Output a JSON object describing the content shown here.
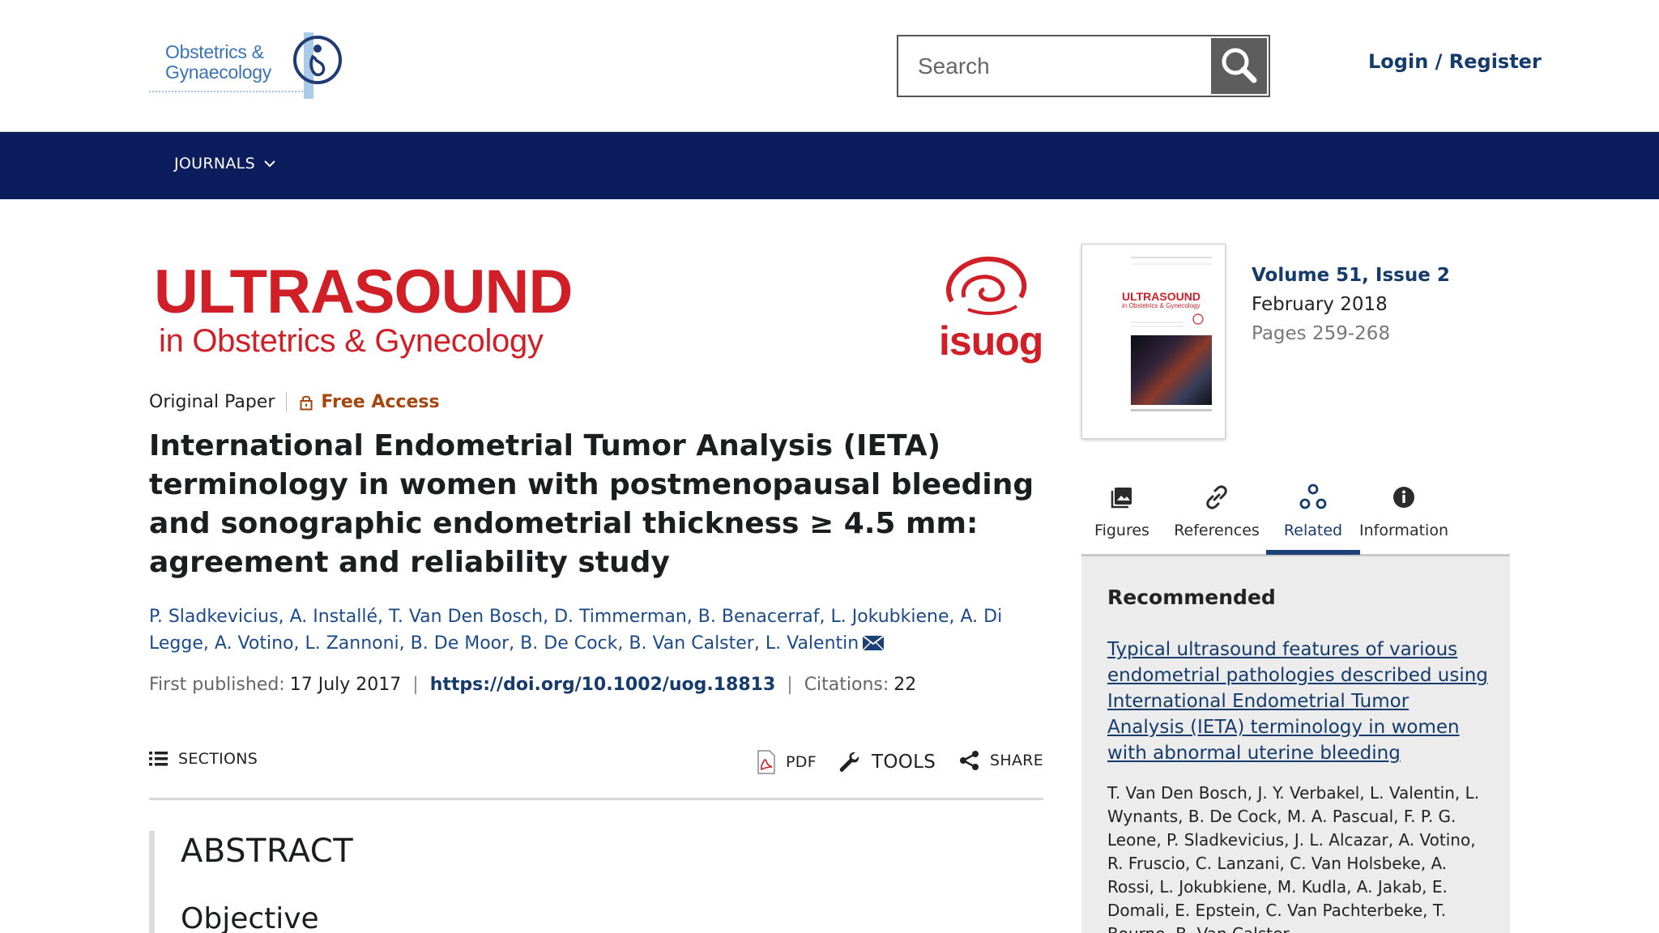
{
  "header": {
    "brand_line1": "Obstetrics &",
    "brand_line2": "Gynaecology",
    "search_placeholder": "Search",
    "login_label": "Login / Register"
  },
  "nav": {
    "journals_label": "JOURNALS"
  },
  "journal": {
    "logo_title": "ULTRASOUND",
    "logo_subtitle": "in Obstetrics & Gynecology",
    "isuog": "isuog"
  },
  "article": {
    "type": "Original Paper",
    "access": "Free Access",
    "title": "International Endometrial Tumor Analysis (IETA) terminology in women with postmenopausal bleeding and sonographic endometrial thickness ≥ 4.5 mm: agreement and reliability study",
    "authors": [
      "P. Sladkevicius",
      "A. Installé",
      "T. Van Den Bosch",
      "D. Timmerman",
      "B. Benacerraf",
      "L. Jokubkiene",
      "A. Di Legge",
      "A. Votino",
      "L. Zannoni",
      "B. De Moor",
      "B. De Cock",
      "B. Van Calster",
      "L. Valentin"
    ],
    "first_published_label": "First published:",
    "first_published": "17 July 2017",
    "doi": "https://doi.org/10.1002/uog.18813",
    "citations_label": "Citations:",
    "citations": "22"
  },
  "toolbar": {
    "sections": "SECTIONS",
    "pdf": "PDF",
    "tools": "TOOLS",
    "share": "SHARE"
  },
  "abstract": {
    "heading": "ABSTRACT",
    "subheading": "Objective"
  },
  "issue": {
    "cover_title": "ULTRASOUND",
    "cover_subtitle": "in Obstetrics & Gynecology",
    "volume": "Volume 51, Issue 2",
    "date": "February 2018",
    "pages": "Pages 259-268"
  },
  "tabs": {
    "figures": "Figures",
    "references": "References",
    "related": "Related",
    "information": "Information"
  },
  "recommended": {
    "heading": "Recommended",
    "link_title": "Typical ultrasound features of various endometrial pathologies described using International Endometrial Tumor Analysis (IETA) terminology in women with abnormal uterine bleeding",
    "authors": "T. Van Den Bosch, J. Y. Verbakel, L. Valentin, L. Wynants, B. De Cock, M. A. Pascual, F. P. G. Leone, P. Sladkevicius, J. L. Alcazar, A. Votino, R. Fruscio, C. Lanzani, C. Van Holsbeke, A. Rossi, L. Jokubkiene, M. Kudla, A. Jakab, E. Domali, E. Epstein, C. Van Pachterbeke, T. Bourne, B. Van Calster"
  },
  "colors": {
    "nav_bg": "#0b1d5c",
    "link": "#153b6c",
    "journal_red": "#d11f27",
    "free_access": "#a5460f"
  }
}
